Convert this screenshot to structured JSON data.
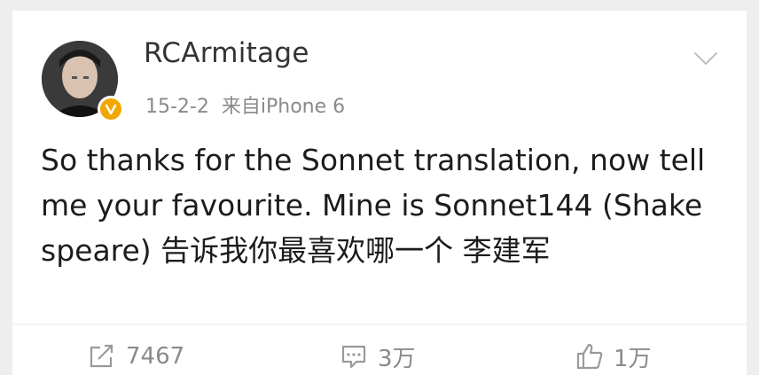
{
  "post": {
    "username": "RCArmitage",
    "date": "15-2-2",
    "source": "来自iPhone 6",
    "text": "So thanks for the Sonnet translation, now tell me your favourite. Mine is Sonnet144 (Shakespeare) 告诉我你最喜欢哪一个  李建军"
  },
  "actions": {
    "repost_count": "7467",
    "comment_count": "3万",
    "like_count": "1万"
  },
  "icons": {
    "avatar": "avatar-photo",
    "verified": "verified-badge-icon",
    "menu": "chevron-down-icon",
    "repost": "repost-icon",
    "comment": "comment-icon",
    "like": "thumbs-up-icon"
  },
  "colors": {
    "verified_badge": "#f0a800",
    "meta_text": "#8a8a8a"
  }
}
